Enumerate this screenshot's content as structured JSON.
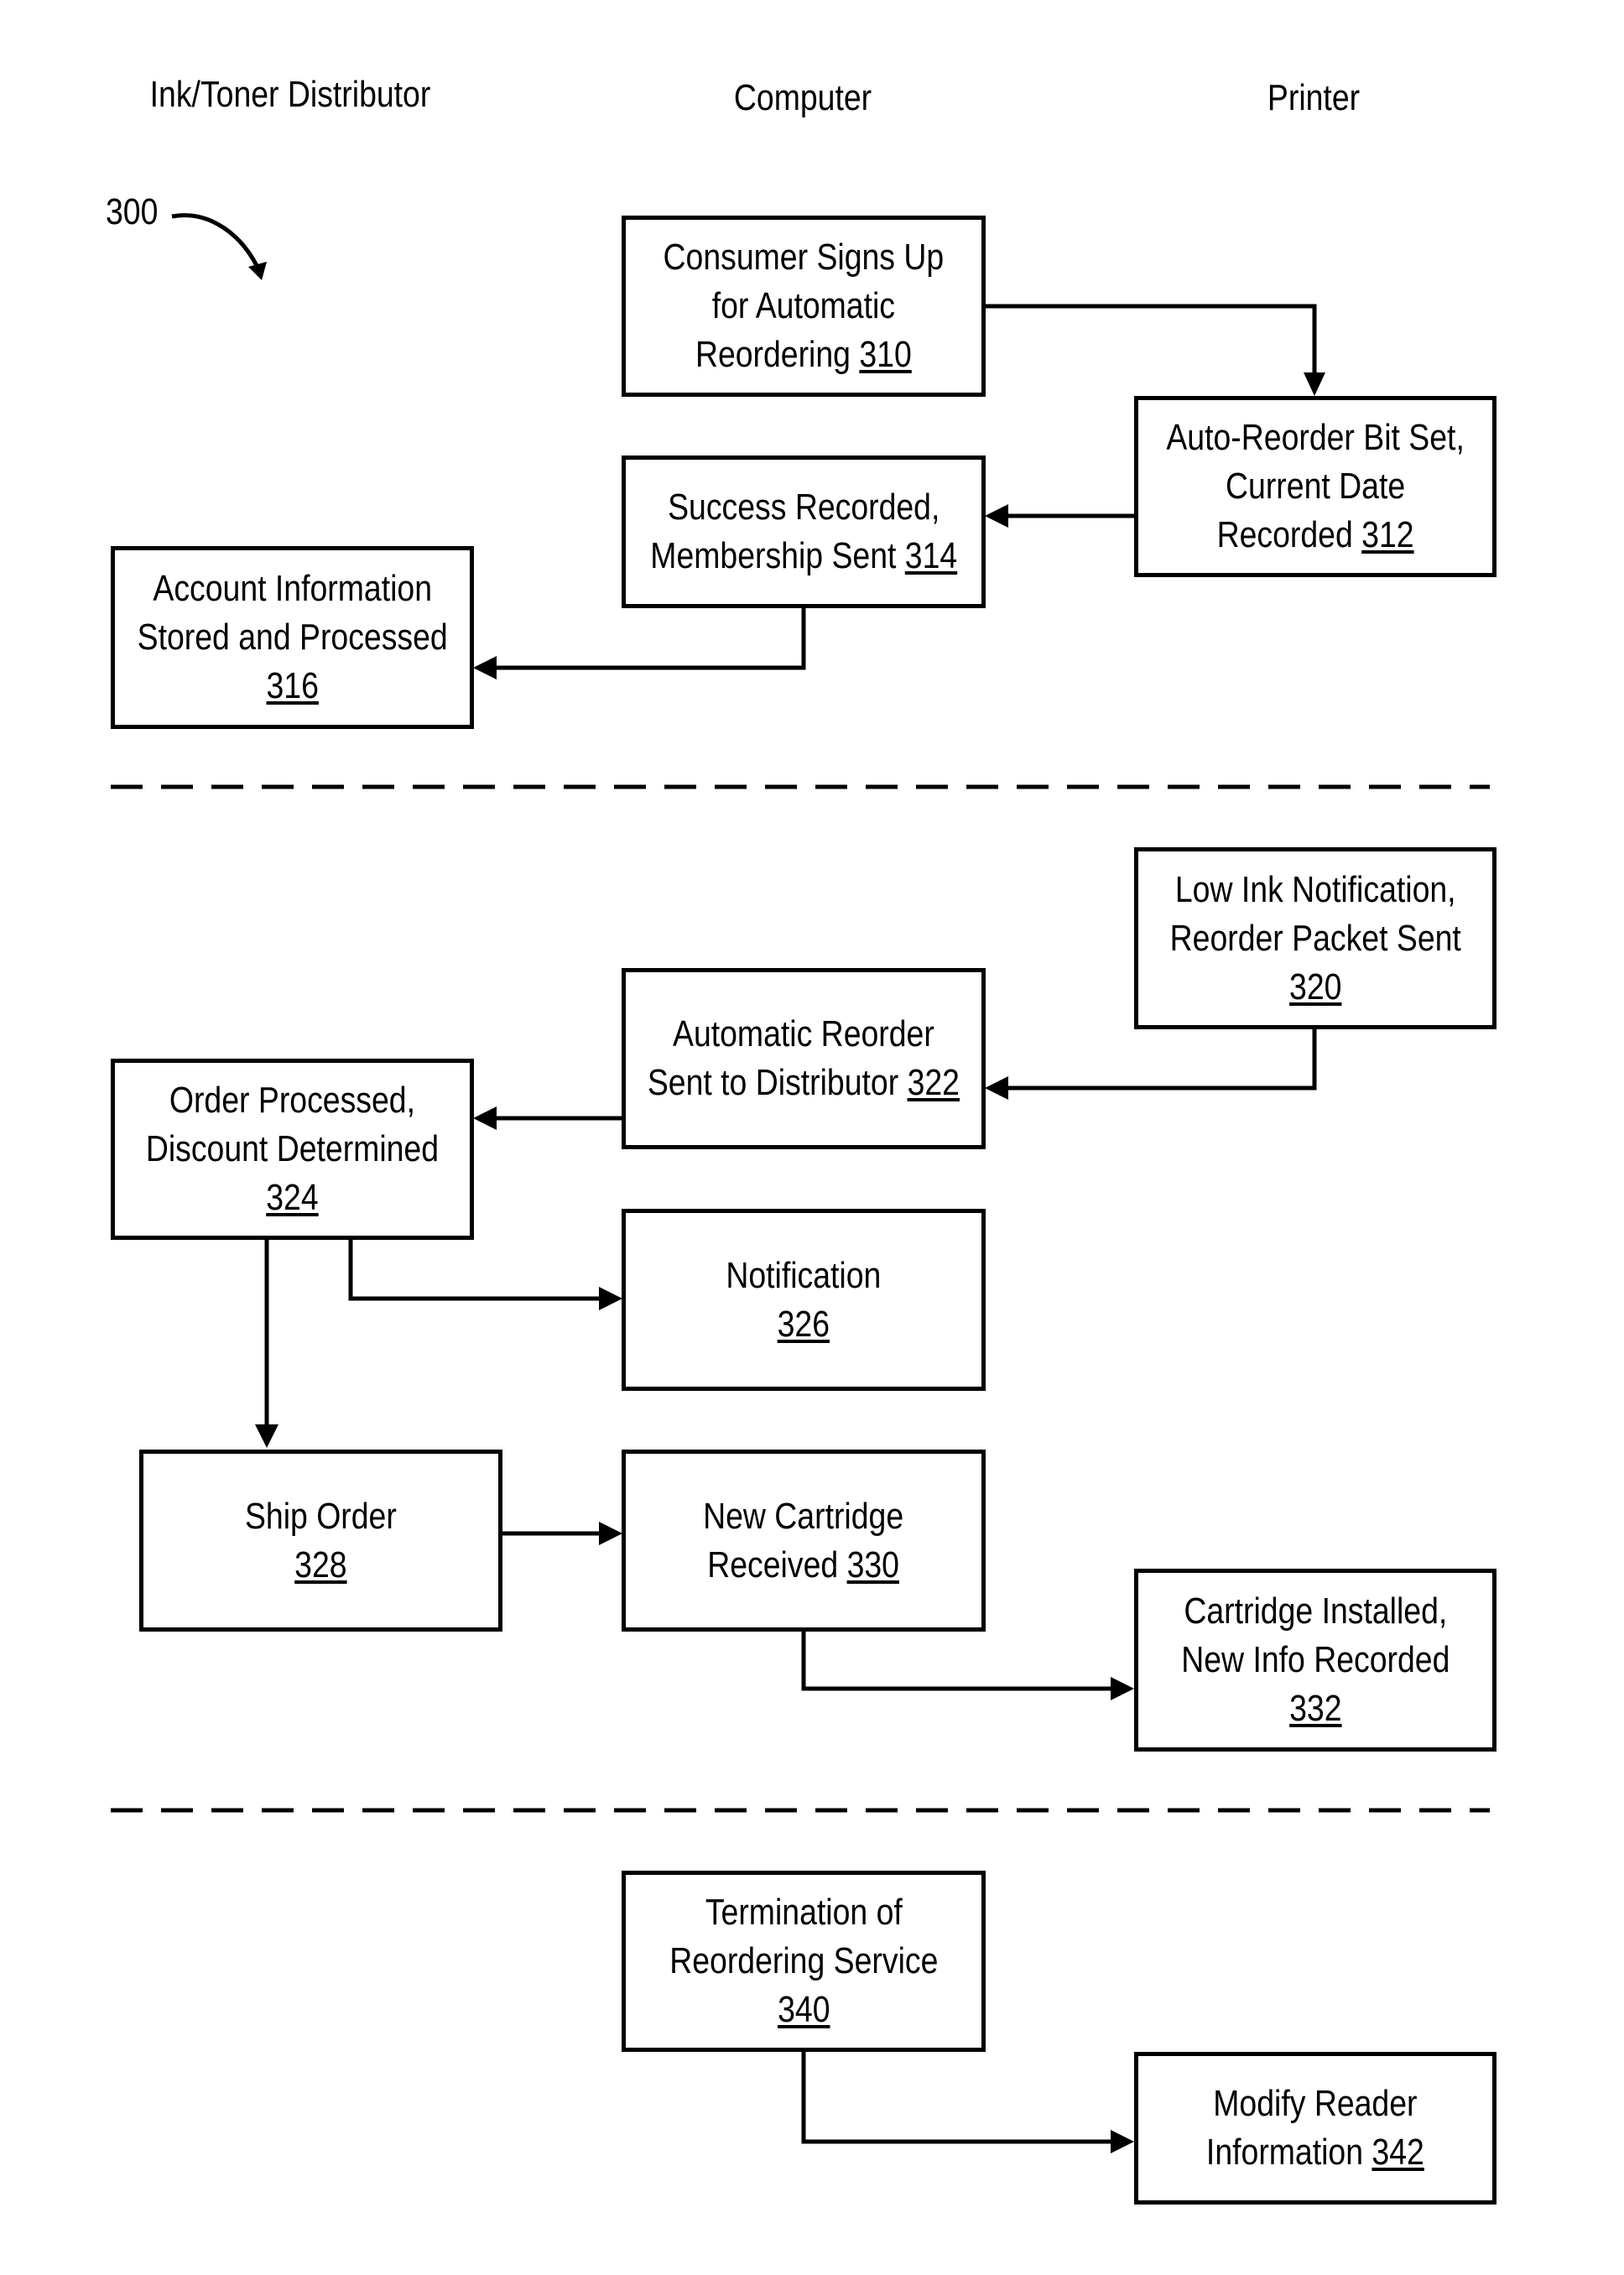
{
  "figure_ref": "300",
  "lanes": [
    "Ink/Toner Distributor",
    "Computer",
    "Printer"
  ],
  "steps": {
    "s310": {
      "lines": [
        "Consumer Signs Up",
        "for Automatic",
        "Reordering"
      ],
      "num": "310"
    },
    "s312": {
      "lines": [
        "Auto-Reorder Bit Set,",
        "Current Date",
        "Recorded"
      ],
      "num": "312"
    },
    "s314": {
      "lines": [
        "Success Recorded,",
        "Membership Sent"
      ],
      "num": "314"
    },
    "s316": {
      "lines": [
        "Account Information",
        "Stored and Processed",
        ""
      ],
      "num": "316"
    },
    "s320": {
      "lines": [
        "Low Ink Notification,",
        "Reorder Packet Sent",
        ""
      ],
      "num": "320"
    },
    "s322": {
      "lines": [
        "Automatic Reorder",
        "Sent to Distributor"
      ],
      "num": "322"
    },
    "s324": {
      "lines": [
        "Order Processed,",
        "Discount Determined",
        ""
      ],
      "num": "324"
    },
    "s326": {
      "lines": [
        "Notification",
        ""
      ],
      "num": "326"
    },
    "s328": {
      "lines": [
        "Ship Order",
        ""
      ],
      "num": "328"
    },
    "s330": {
      "lines": [
        "New Cartridge",
        "Received"
      ],
      "num": "330"
    },
    "s332": {
      "lines": [
        "Cartridge Installed,",
        "New Info Recorded",
        ""
      ],
      "num": "332"
    },
    "s340": {
      "lines": [
        "Termination of",
        "Reordering Service",
        ""
      ],
      "num": "340"
    },
    "s342": {
      "lines": [
        "Modify Reader",
        "Information "
      ],
      "num": "342"
    }
  }
}
